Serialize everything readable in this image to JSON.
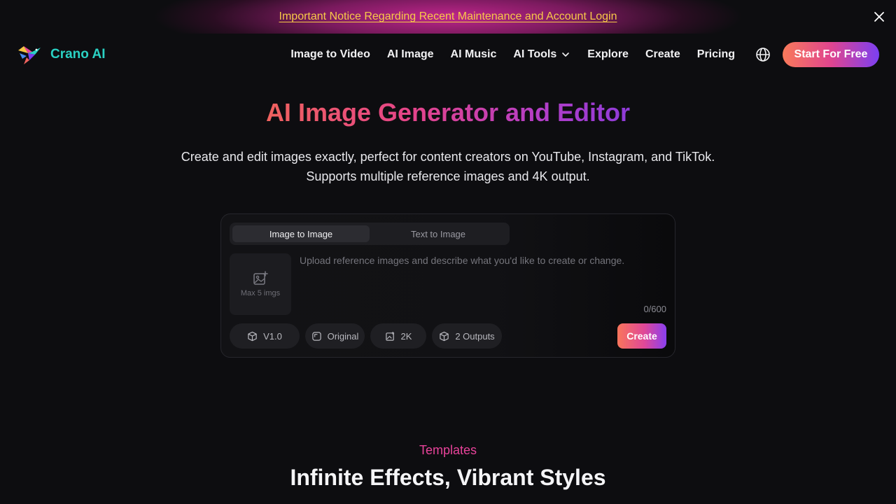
{
  "notice": {
    "text": "Important Notice Regarding Recent Maintenance and Account Login"
  },
  "brand": {
    "name": "Crano AI"
  },
  "nav": {
    "items": [
      {
        "label": "Image to Video"
      },
      {
        "label": "AI Image"
      },
      {
        "label": "AI Music"
      },
      {
        "label": "AI Tools"
      },
      {
        "label": "Explore"
      },
      {
        "label": "Create"
      },
      {
        "label": "Pricing"
      }
    ],
    "cta_label": "Start For Free"
  },
  "hero": {
    "title": "AI Image Generator and Editor",
    "subtitle_line1": "Create and edit images exactly, perfect for content creators on YouTube, Instagram, and TikTok.",
    "subtitle_line2": "Supports multiple reference images and 4K output."
  },
  "editor": {
    "tabs": [
      {
        "label": "Image to Image",
        "active": true
      },
      {
        "label": "Text to Image",
        "active": false
      }
    ],
    "upload_label": "Max 5 imgs",
    "prompt_placeholder": "Upload reference images and describe what you'd like to create or change.",
    "counter": "0/600",
    "chips": {
      "version": "V1.0",
      "ratio": "Original",
      "resolution": "2K",
      "outputs": "2 Outputs"
    },
    "create_label": "Create"
  },
  "templates": {
    "eyebrow": "Templates",
    "title": "Infinite Effects, Vibrant Styles"
  },
  "colors": {
    "background": "#0d0d10",
    "brand_teal": "#2ad1c3",
    "notice_gold": "#f7c948",
    "accent_pink": "#e8439a",
    "accent_purple": "#7b3ff2"
  }
}
